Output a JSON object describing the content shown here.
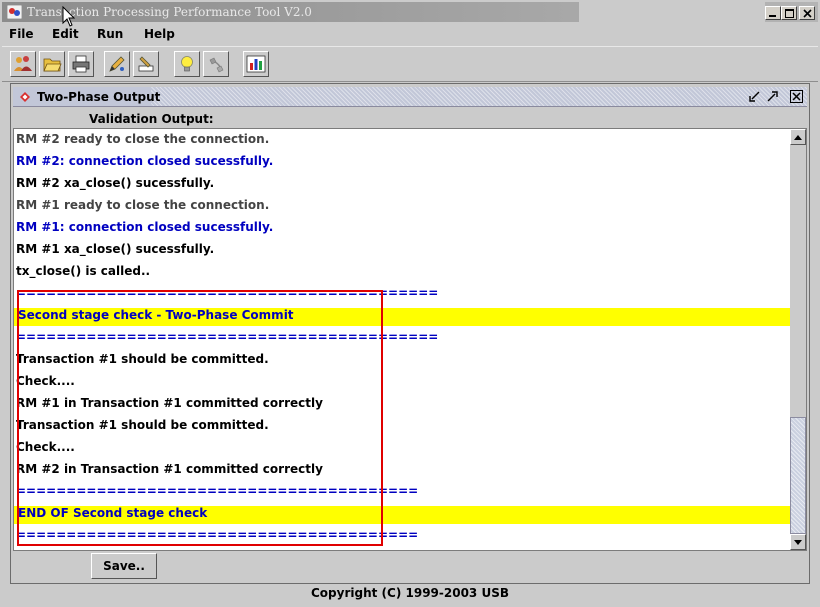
{
  "window": {
    "title": "Transaction Processing Performance Tool V2.0"
  },
  "menu": [
    {
      "label": "File"
    },
    {
      "label": "Edit"
    },
    {
      "label": "Run"
    },
    {
      "label": "Help"
    }
  ],
  "toolbar": {
    "icons": [
      "people-icon",
      "folder-open-icon",
      "printer-icon",
      "edit-pencil-icon",
      "stamp-icon",
      "lightbulb-icon",
      "plug-icon",
      "chart-window-icon"
    ]
  },
  "internal_frame": {
    "title": "Two-Phase Output"
  },
  "output": {
    "label": "Validation Output:",
    "lines": [
      {
        "text": "RM #2 ready to close the connection.",
        "color": "#444444",
        "highlight": false
      },
      {
        "text": "RM #2: connection closed sucessfully.",
        "color": "#0000c0",
        "highlight": false
      },
      {
        "text": "RM #2 xa_close() sucessfully.",
        "color": "#000000",
        "highlight": false
      },
      {
        "text": "RM #1 ready to close the connection.",
        "color": "#444444",
        "highlight": false
      },
      {
        "text": "RM #1: connection closed sucessfully.",
        "color": "#0000c0",
        "highlight": false
      },
      {
        "text": "RM #1 xa_close() sucessfully.",
        "color": "#000000",
        "highlight": false
      },
      {
        "text": "tx_close() is called..",
        "color": "#000000",
        "highlight": false
      },
      {
        "text": "==========================================",
        "color": "#0000c0",
        "highlight": false
      },
      {
        "text": "Second stage check - Two-Phase Commit",
        "color": "#0000c0",
        "highlight": true
      },
      {
        "text": "==========================================",
        "color": "#0000c0",
        "highlight": false
      },
      {
        "text": "Transaction #1 should be committed.",
        "color": "#000000",
        "highlight": false
      },
      {
        "text": "Check....",
        "color": "#000000",
        "highlight": false
      },
      {
        "text": "RM #1 in Transaction #1 committed correctly",
        "color": "#000000",
        "highlight": false
      },
      {
        "text": "Transaction #1 should be committed.",
        "color": "#000000",
        "highlight": false
      },
      {
        "text": "Check....",
        "color": "#000000",
        "highlight": false
      },
      {
        "text": "RM #2 in Transaction #1 committed correctly",
        "color": "#000000",
        "highlight": false
      },
      {
        "text": "========================================",
        "color": "#0000c0",
        "highlight": false
      },
      {
        "text": "END OF Second stage check",
        "color": "#0000c0",
        "highlight": true
      },
      {
        "text": "========================================",
        "color": "#0000c0",
        "highlight": false
      }
    ]
  },
  "scroll": {
    "thumb_start": 0.7,
    "thumb_end": 1.0
  },
  "buttons": {
    "save": "Save.."
  },
  "footer": {
    "copyright": "Copyright (C) 1999-2003 USB"
  }
}
